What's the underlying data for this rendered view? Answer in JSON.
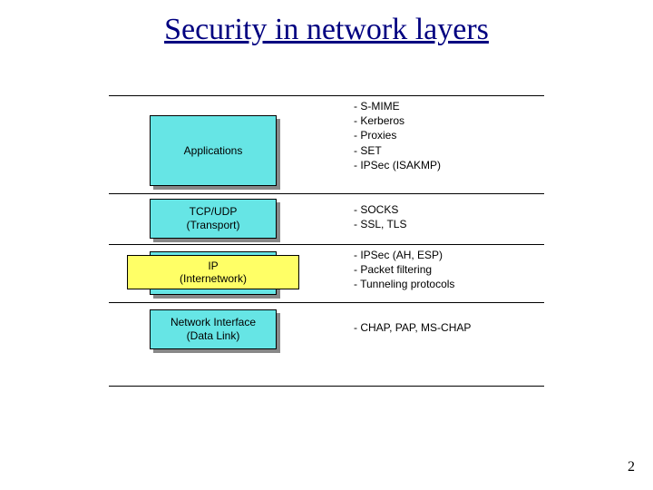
{
  "title": "Security in network layers",
  "page_number": "2",
  "layers": [
    {
      "name": "Applications",
      "subtitle": "",
      "color": "cyan",
      "protocols": [
        "S-MIME",
        "Kerberos",
        "Proxies",
        "SET",
        "IPSec (ISAKMP)"
      ]
    },
    {
      "name": "TCP/UDP",
      "subtitle": "(Transport)",
      "color": "cyan",
      "protocols": [
        "SOCKS",
        "SSL, TLS"
      ]
    },
    {
      "name": "IP",
      "subtitle": "(Internetwork)",
      "color": "yellow",
      "protocols": [
        "IPSec (AH, ESP)",
        "Packet filtering",
        "Tunneling protocols"
      ]
    },
    {
      "name": "Network Interface",
      "subtitle": "(Data Link)",
      "color": "cyan",
      "protocols": [
        "CHAP, PAP, MS-CHAP"
      ]
    }
  ]
}
